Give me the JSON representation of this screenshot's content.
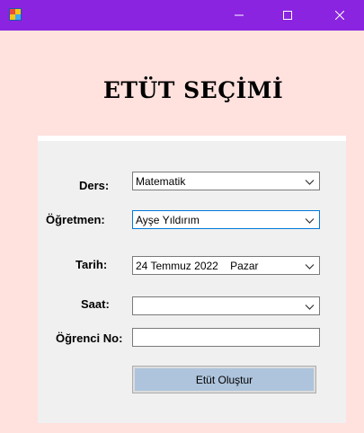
{
  "window": {
    "icons": {
      "app": "app-icon",
      "minimize": "minimize-icon",
      "maximize": "maximize-icon",
      "close": "close-icon"
    }
  },
  "heading": "ETÜT SEÇİMİ",
  "form": {
    "ders": {
      "label": "Ders:",
      "value": "Matematik"
    },
    "ogretmen": {
      "label": "Öğretmen:",
      "value": "Ayşe Yıldırım"
    },
    "tarih": {
      "label": "Tarih:",
      "value": "24 Temmuz 2022    Pazar"
    },
    "saat": {
      "label": "Saat:",
      "value": ""
    },
    "ogrenci_no": {
      "label": "Öğrenci No:",
      "value": ""
    },
    "submit_label": "Etüt Oluştur"
  },
  "colors": {
    "titlebar": "#8a24e0",
    "background": "#ffe1de",
    "button": "#aec4dc",
    "focus": "#0078d7"
  }
}
